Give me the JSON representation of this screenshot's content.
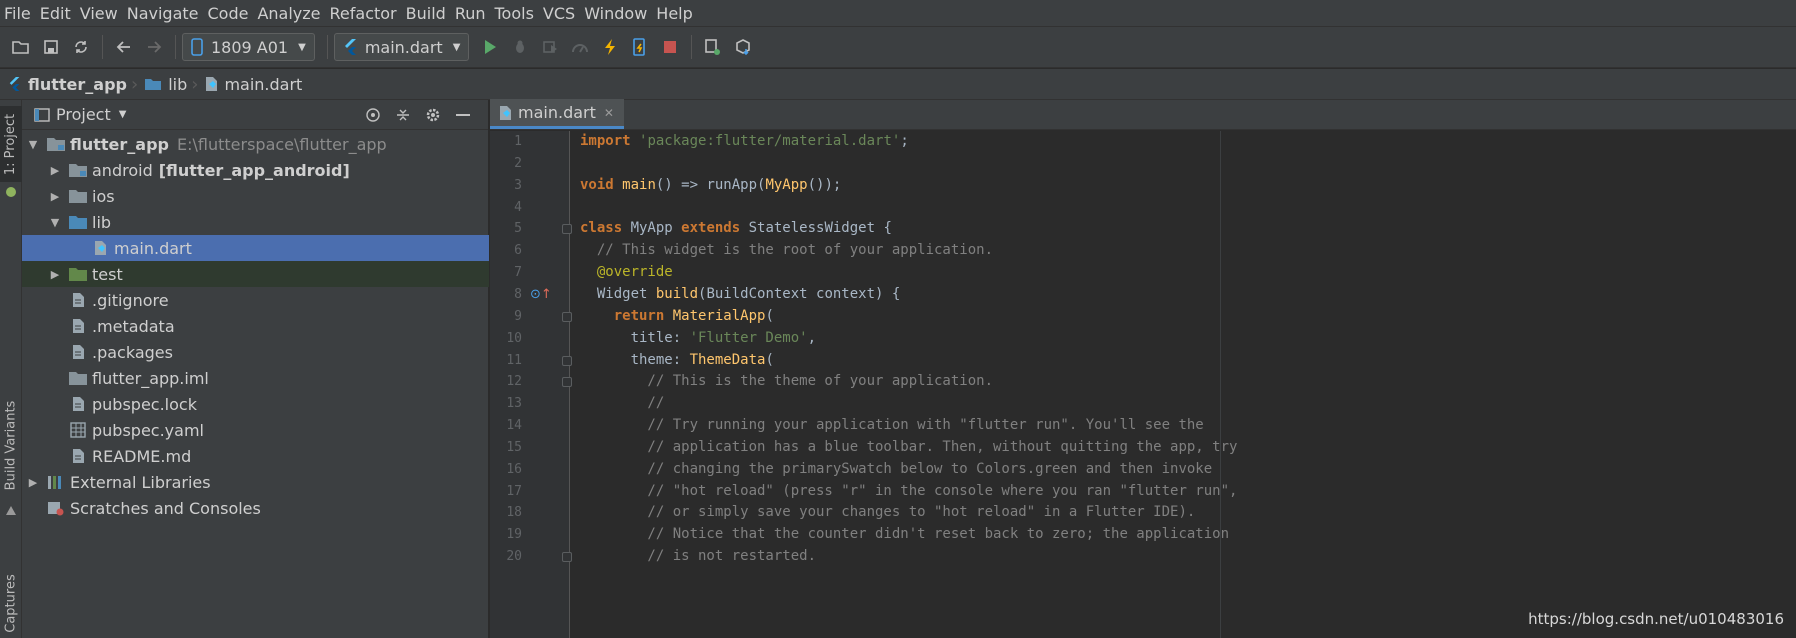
{
  "menu": [
    "File",
    "Edit",
    "View",
    "Navigate",
    "Code",
    "Analyze",
    "Refactor",
    "Build",
    "Run",
    "Tools",
    "VCS",
    "Window",
    "Help"
  ],
  "toolbar": {
    "device": "1809 A01",
    "run_config": "main.dart"
  },
  "breadcrumb": [
    "flutter_app",
    "lib",
    "main.dart"
  ],
  "left_strip": {
    "project_tab": "1: Project",
    "build_variants_tab": "Build Variants",
    "captures_tab": "Captures"
  },
  "project_panel": {
    "title": "Project",
    "tree": [
      {
        "label": "flutter_app",
        "path": "E:\\flutterspace\\flutter_app",
        "depth": 0,
        "expanded": true,
        "icon": "module-folder-icon"
      },
      {
        "label": "android",
        "suffix": "[flutter_app_android]",
        "depth": 1,
        "expanded": false,
        "icon": "module-folder-icon"
      },
      {
        "label": "ios",
        "depth": 1,
        "expanded": false,
        "icon": "folder-icon"
      },
      {
        "label": "lib",
        "depth": 1,
        "expanded": true,
        "icon": "source-folder-icon"
      },
      {
        "label": "main.dart",
        "depth": 2,
        "icon": "dart-file-icon",
        "selected": true
      },
      {
        "label": "test",
        "depth": 1,
        "expanded": false,
        "icon": "test-folder-icon"
      },
      {
        "label": ".gitignore",
        "depth": 1,
        "icon": "file-icon"
      },
      {
        "label": ".metadata",
        "depth": 1,
        "icon": "file-icon"
      },
      {
        "label": ".packages",
        "depth": 1,
        "icon": "file-icon"
      },
      {
        "label": "flutter_app.iml",
        "depth": 1,
        "icon": "iml-file-icon"
      },
      {
        "label": "pubspec.lock",
        "depth": 1,
        "icon": "file-icon"
      },
      {
        "label": "pubspec.yaml",
        "depth": 1,
        "icon": "yaml-file-icon"
      },
      {
        "label": "README.md",
        "depth": 1,
        "icon": "file-icon"
      },
      {
        "label": "External Libraries",
        "depth": 0,
        "expanded": false,
        "icon": "libraries-icon"
      },
      {
        "label": "Scratches and Consoles",
        "depth": 0,
        "icon": "scratches-icon"
      }
    ]
  },
  "editor": {
    "tab": "main.dart",
    "lines": [
      "1",
      "2",
      "3",
      "4",
      "5",
      "6",
      "7",
      "8",
      "9",
      "10",
      "11",
      "12",
      "13",
      "14",
      "15",
      "16",
      "17",
      "18",
      "19",
      "20"
    ],
    "code": {
      "l1_kw": "import ",
      "l1_str": "'package:flutter/material.dart'",
      "l1_end": ";",
      "l3_kw": "void ",
      "l3_fn": "main",
      "l3_mid": "() => runApp(",
      "l3_cls": "MyApp",
      "l3_end": "());",
      "l5_kw1": "class ",
      "l5_name": "MyApp ",
      "l5_kw2": "extends ",
      "l5_end": "StatelessWidget {",
      "l6": "  // This widget is the root of your application.",
      "l7": "  @override",
      "l8_a": "  Widget ",
      "l8_fn": "build",
      "l8_b": "(BuildContext context) {",
      "l9_kw": "    return ",
      "l9_cls": "MaterialApp",
      "l9_end": "(",
      "l10_a": "      title: ",
      "l10_str": "'Flutter Demo'",
      "l10_end": ",",
      "l11_a": "      theme: ",
      "l11_cls": "ThemeData",
      "l11_end": "(",
      "l12": "        // This is the theme of your application.",
      "l13": "        //",
      "l14": "        // Try running your application with \"flutter run\". You'll see the",
      "l15": "        // application has a blue toolbar. Then, without quitting the app, try",
      "l16": "        // changing the primarySwatch below to Colors.green and then invoke",
      "l17": "        // \"hot reload\" (press \"r\" in the console where you ran \"flutter run\",",
      "l18": "        // or simply save your changes to \"hot reload\" in a Flutter IDE).",
      "l19": "        // Notice that the counter didn't reset back to zero; the application",
      "l20": "        // is not restarted."
    }
  },
  "watermark": "https://blog.csdn.net/u010483016"
}
